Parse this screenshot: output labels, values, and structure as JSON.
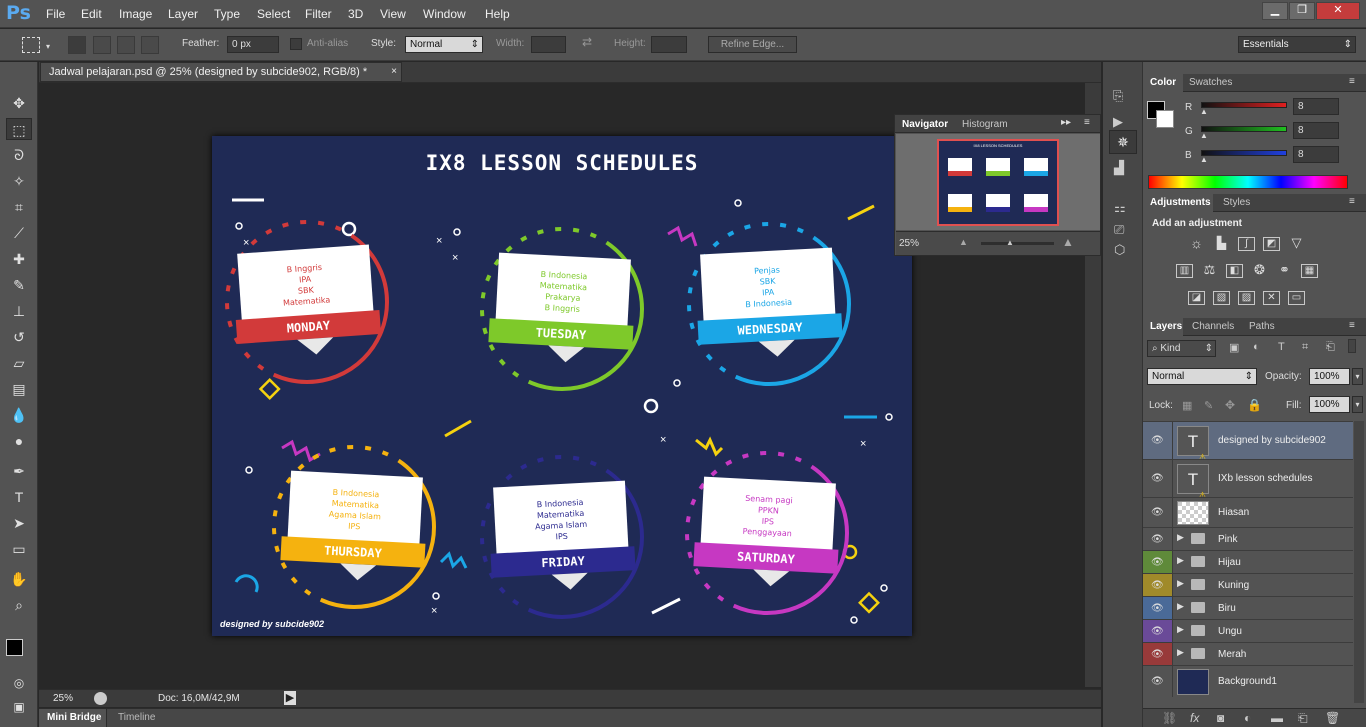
{
  "app": {
    "logo": "Ps"
  },
  "menu": [
    "File",
    "Edit",
    "Image",
    "Layer",
    "Type",
    "Select",
    "Filter",
    "3D",
    "View",
    "Window",
    "Help"
  ],
  "window_controls": {
    "min": "▁",
    "restore": "❐",
    "close": "✕"
  },
  "options": {
    "feather_label": "Feather:",
    "feather_value": "0 px",
    "antialias_label": "Anti-alias",
    "style_label": "Style:",
    "style_value": "Normal",
    "width_label": "Width:",
    "height_label": "Height:",
    "refine_edge": "Refine Edge...",
    "workspace": "Essentials"
  },
  "document": {
    "tab_title": "Jadwal pelajaran.psd @ 25% (designed by subcide902, RGB/8) *",
    "close": "×",
    "zoom": "25%",
    "doc_info": "Doc: 16,0M/42,9M"
  },
  "bottom_tabs": [
    "Mini Bridge",
    "Timeline"
  ],
  "artwork": {
    "title": "IX8  LESSON SCHEDULES",
    "credit": "designed by subcide902",
    "days": [
      {
        "day": "MONDAY",
        "color": "#d23a3a",
        "subjects": [
          "B Inggris",
          "IPA",
          "SBK",
          "Matematika"
        ]
      },
      {
        "day": "TUESDAY",
        "color": "#7ec92a",
        "subjects": [
          "B Indonesia",
          "Matematika",
          "Prakarya",
          "B Inggris"
        ]
      },
      {
        "day": "WEDNESDAY",
        "color": "#1ba6e6",
        "subjects": [
          "Penjas",
          "SBK",
          "IPA",
          "B Indonesia"
        ]
      },
      {
        "day": "THURSDAY",
        "color": "#f5b20f",
        "subjects": [
          "B Indonesia",
          "Matematika",
          "Agama Islam",
          "IPS"
        ]
      },
      {
        "day": "FRIDAY",
        "color": "#2c2a8f",
        "subjects": [
          "B Indonesia",
          "Matematika",
          "Agama Islam",
          "IPS"
        ]
      },
      {
        "day": "SATURDAY",
        "color": "#c638c2",
        "subjects": [
          "Senam pagi",
          "PPKN",
          "IPS",
          "Penggayaan"
        ]
      }
    ]
  },
  "navigator": {
    "tabs": [
      "Navigator",
      "Histogram"
    ],
    "thumb_title": "IX8 LESSON SCHEDULES",
    "zoom": "25%",
    "view_box_color": "#e05050"
  },
  "color_panel": {
    "tabs": [
      "Color",
      "Swatches"
    ],
    "channels": [
      {
        "label": "R",
        "value": "8",
        "color": "#e02020"
      },
      {
        "label": "G",
        "value": "8",
        "color": "#20c020"
      },
      {
        "label": "B",
        "value": "8",
        "color": "#2040e0"
      }
    ]
  },
  "adjustments": {
    "tabs": [
      "Adjustments",
      "Styles"
    ],
    "heading": "Add an adjustment"
  },
  "layers_panel": {
    "tabs": [
      "Layers",
      "Channels",
      "Paths"
    ],
    "kind": "Kind",
    "blend": "Normal",
    "opacity_label": "Opacity:",
    "opacity": "100%",
    "lock_label": "Lock:",
    "fill_label": "Fill:",
    "fill": "100%",
    "layers": [
      {
        "name": "designed by subcide902",
        "type": "text",
        "selected": true,
        "eye_color": ""
      },
      {
        "name": "IXb  lesson schedules",
        "type": "text",
        "selected": false,
        "eye_color": ""
      },
      {
        "name": "Hiasan",
        "type": "raster",
        "selected": false,
        "eye_color": ""
      },
      {
        "name": "Pink",
        "type": "group",
        "selected": false,
        "eye_color": ""
      },
      {
        "name": "Hijau",
        "type": "group",
        "selected": false,
        "eye_color": "#5f8a3a"
      },
      {
        "name": "Kuning",
        "type": "group",
        "selected": false,
        "eye_color": "#a08a2a"
      },
      {
        "name": "Biru",
        "type": "group",
        "selected": false,
        "eye_color": "#4a6a98"
      },
      {
        "name": "Ungu",
        "type": "group",
        "selected": false,
        "eye_color": "#6a4a98"
      },
      {
        "name": "Merah",
        "type": "group",
        "selected": false,
        "eye_color": "#983a3a"
      },
      {
        "name": "Background1",
        "type": "background",
        "selected": false,
        "eye_color": ""
      }
    ],
    "footer_icons": [
      "link-icon",
      "fx-icon",
      "mask-icon",
      "adjustment-icon",
      "group-icon",
      "new-layer-icon",
      "trash-icon"
    ]
  }
}
